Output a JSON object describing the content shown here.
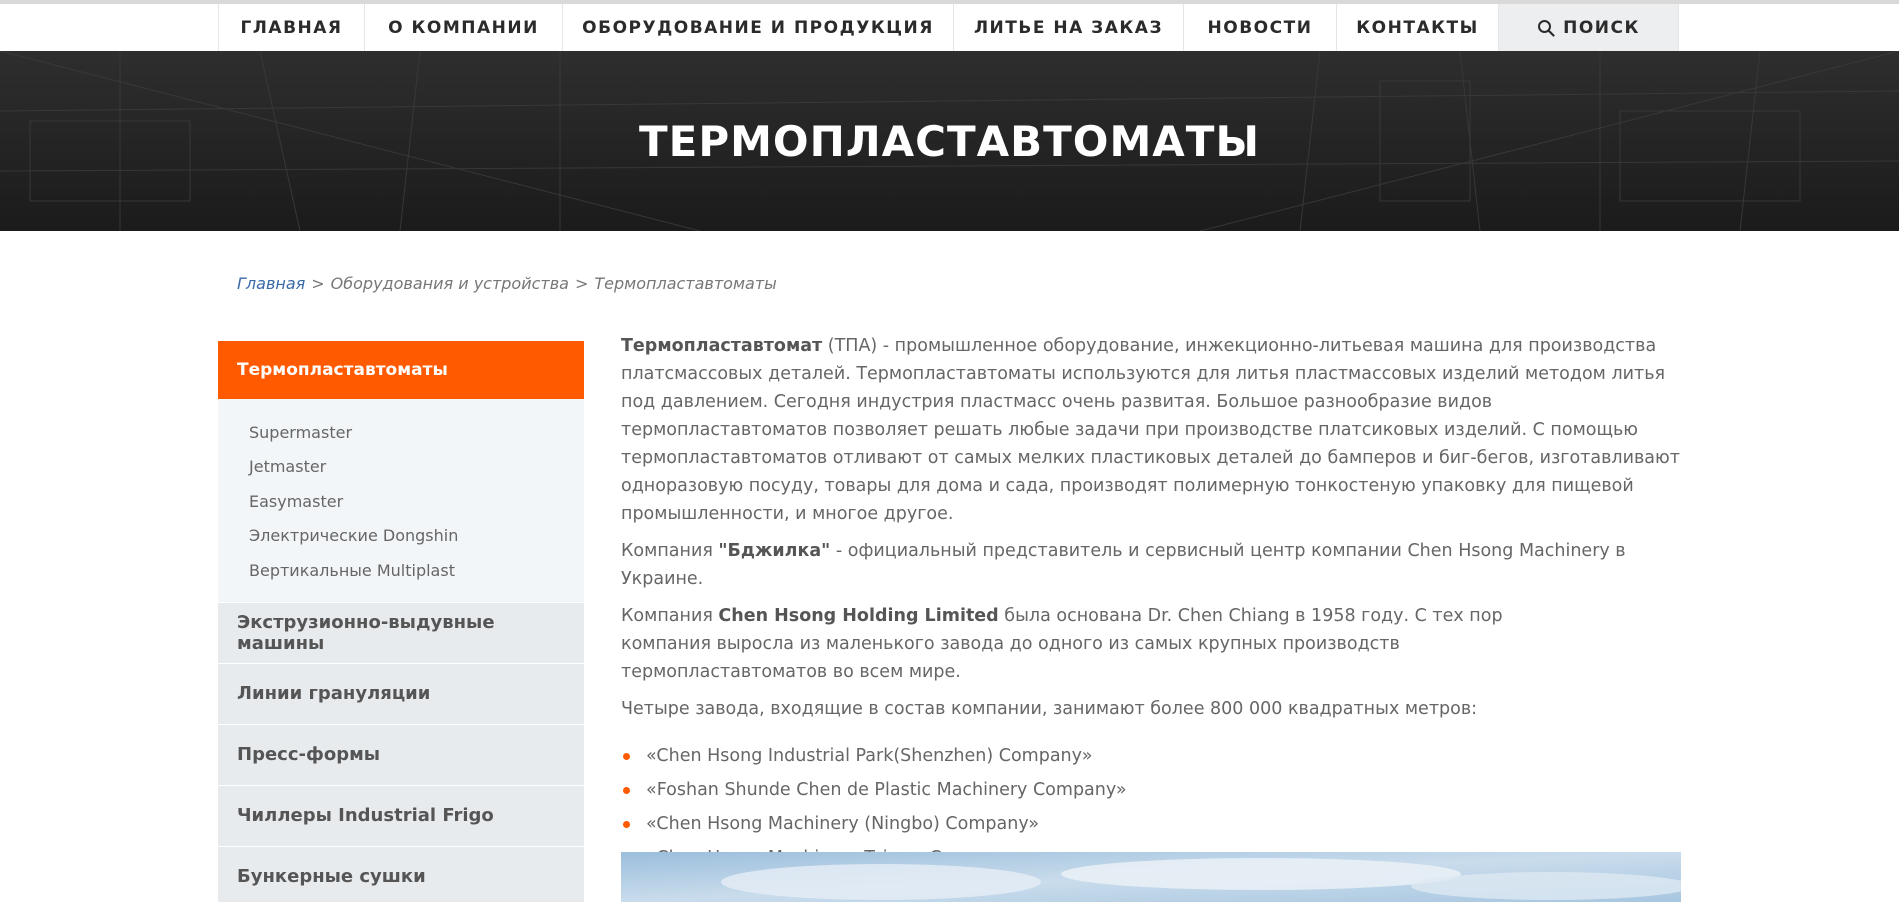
{
  "nav": {
    "items": [
      {
        "label": "ГЛАВНАЯ"
      },
      {
        "label": "О КОМПАНИИ"
      },
      {
        "label": "ОБОРУДОВАНИЕ И ПРОДУКЦИЯ"
      },
      {
        "label": "ЛИТЬЕ НА ЗАКАЗ"
      },
      {
        "label": "НОВОСТИ"
      },
      {
        "label": "КОНТАКТЫ"
      }
    ],
    "search_label": "ПОИСК"
  },
  "hero": {
    "title": "ТЕРМОПЛАСТАВТОМАТЫ"
  },
  "breadcrumb": {
    "home": "Главная",
    "separator": ">",
    "level2": "Оборудования и устройства",
    "current": "Термопластавтоматы"
  },
  "sidebar": {
    "active": "Термопластавтоматы",
    "sub_items": [
      "Supermaster",
      "Jetmaster",
      "Easymaster",
      "Электрические Dongshin",
      "Вертикальные Multiplast"
    ],
    "items": [
      "Экструзионно-выдувные машины",
      "Линии грануляции",
      "Пресс-формы",
      "Чиллеры Industrial Frigo",
      "Бункерные сушки"
    ]
  },
  "content": {
    "p1_bold": "Термопластавтомат",
    "p1_text": " (ТПА) - промышленное оборудование, инжекционно-литьевая машина для производства платсмассовых деталей. Термопластавтоматы используются для литья пластмассовых изделий методом литья под давлением. Сегодня индустрия пластмасс очень развитая. Большое разнообразие видов термопластавтоматов позволяет решать любые задачи при производстве платсиковых изделий. С помощью термопластавтоматов отливают от самых мелких пластиковых деталей до бамперов и биг-бегов, изготавливают одноразовую посуду, товары для дома и сада, производят полимерную тонкостеную упаковку для пищевой промышленности, и многое другое.",
    "p2_pre": "Компания ",
    "p2_bold": "\"Бджилка\"",
    "p2_text": " - официальный представитель и сервисный центр компании Chen Hsong Machinery в Украине.",
    "p3_pre": "Компания ",
    "p3_bold": "Chen Hsong Holding Limited",
    "p3_text": " была основана Dr. Chen Chiang в 1958 году. С тех пор компания выросла из маленького завода до одного из самых крупных производств термопластавтоматов во всем мире.",
    "p4": "Четыре завода, входящие в состав компании, занимают более 800 000 квадратных метров:",
    "factories": [
      "«Chen Hsong Industrial Park(Shenzhen) Company»",
      "«Foshan Shunde Chen de Plastic Machinery Company»",
      "«Chen Hsong Machinery (Ningbo) Company»",
      "«Chen Hsong Machinery Taiwan Company»"
    ]
  },
  "colors": {
    "accent": "#ff5a00",
    "hero_bg": "#262626",
    "sidebar_item_bg": "#e8ebee",
    "sidebar_sub_bg": "#f3f6f8",
    "link": "#3b6aa8"
  },
  "icons": {
    "search": "magnifier-icon"
  }
}
